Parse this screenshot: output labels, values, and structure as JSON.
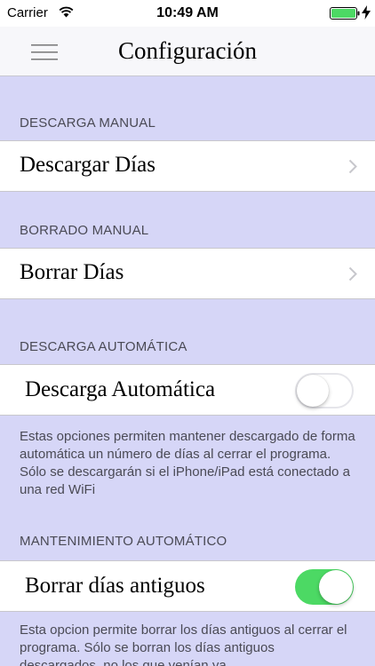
{
  "status_bar": {
    "carrier": "Carrier",
    "time": "10:49 AM"
  },
  "nav": {
    "title": "Configuración",
    "menu_icon": "hamburger-menu-icon"
  },
  "sections": [
    {
      "header": "DESCARGA MANUAL",
      "row": {
        "label": "Descargar Días",
        "accessory": "chevron-right-icon"
      }
    },
    {
      "header": "BORRADO MANUAL",
      "row": {
        "label": "Borrar Días",
        "accessory": "chevron-right-icon"
      }
    },
    {
      "header": "DESCARGA AUTOMÁTICA",
      "row": {
        "label": "Descarga Automática",
        "switch_on": false
      },
      "footer": "Estas opciones permiten mantener descargado de forma automática un número de días al cerrar el programa. Sólo se descargarán si el iPhone/iPad está conectado a una red WiFi"
    },
    {
      "header": "MANTENIMIENTO AUTOMÁTICO",
      "row": {
        "label": "Borrar días antiguos",
        "switch_on": true
      },
      "footer": "Esta opcion permite borrar los días antiguos al cerrar el programa. Sólo se borran los días antiguos descargados, no los que venían ya"
    }
  ],
  "colors": {
    "background": "#d6d6f7",
    "switch_on": "#4cd964",
    "section_text": "#4a4a55"
  }
}
